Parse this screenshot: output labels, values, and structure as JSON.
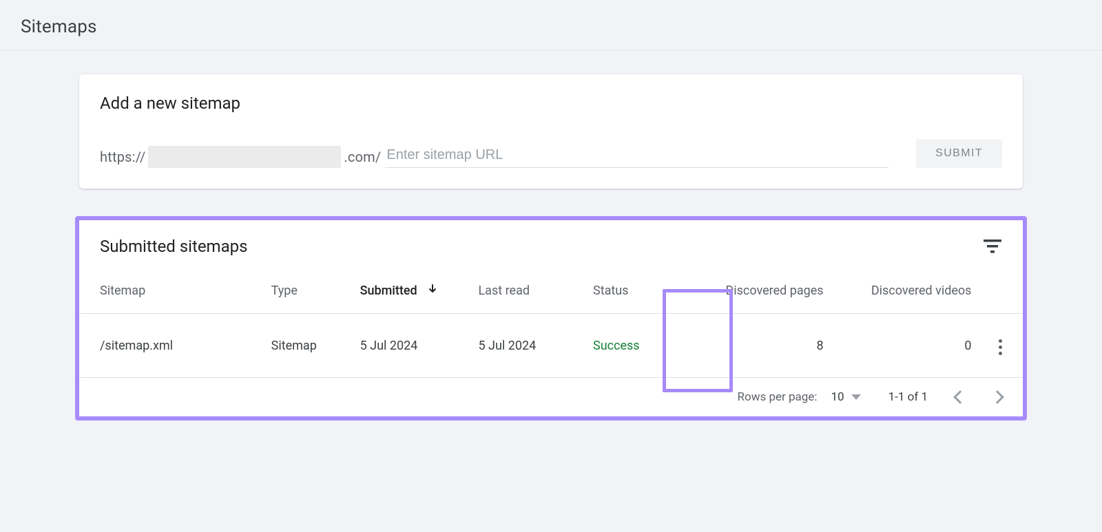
{
  "page_title": "Sitemaps",
  "add_card": {
    "title": "Add a new sitemap",
    "url_prefix_scheme": "https://",
    "url_prefix_suffix": ".com/",
    "input_placeholder": "Enter sitemap URL",
    "submit_label": "SUBMIT"
  },
  "submitted": {
    "title": "Submitted sitemaps",
    "columns": {
      "sitemap": "Sitemap",
      "type": "Type",
      "submitted": "Submitted",
      "last_read": "Last read",
      "status": "Status",
      "discovered_pages": "Discovered pages",
      "discovered_videos": "Discovered videos"
    },
    "rows": [
      {
        "sitemap": "/sitemap.xml",
        "type": "Sitemap",
        "submitted": "5 Jul 2024",
        "last_read": "5 Jul 2024",
        "status": "Success",
        "discovered_pages": "8",
        "discovered_videos": "0"
      }
    ],
    "pagination": {
      "rows_per_page_label": "Rows per page:",
      "rows_per_page_value": "10",
      "range": "1-1 of 1"
    }
  }
}
